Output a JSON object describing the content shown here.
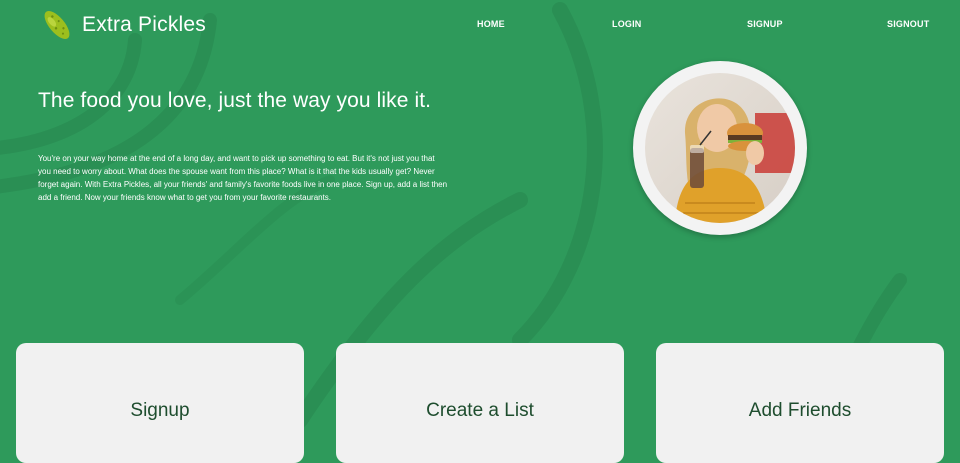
{
  "header": {
    "brand_name": "Extra Pickles",
    "logo_icon": "pickle-icon",
    "nav": [
      {
        "label": "HOME"
      },
      {
        "label": "LOGIN"
      },
      {
        "label": "SIGNUP"
      },
      {
        "label": "SIGNOUT"
      }
    ]
  },
  "hero": {
    "headline": "The food you love, just the way you like it.",
    "intro": "You're on your way home at the end of a long day, and want to pick up something to eat. But it's not just you that you need to worry about. What does the spouse want from this place? What is it that the kids usually get? Never forget again. With Extra Pickles, all your friends' and family's favorite foods live in one place. Sign up, add a list then add a friend. Now your friends know what to get you from your favorite restaurants.",
    "photo_icon": "woman-eating-burger-photo"
  },
  "cards": [
    {
      "title": "Signup"
    },
    {
      "title": "Create a List"
    },
    {
      "title": "Add Friends"
    }
  ],
  "colors": {
    "background": "#2e9a5b",
    "card": "#f1f1f1",
    "card_text": "#1e4d2e"
  }
}
